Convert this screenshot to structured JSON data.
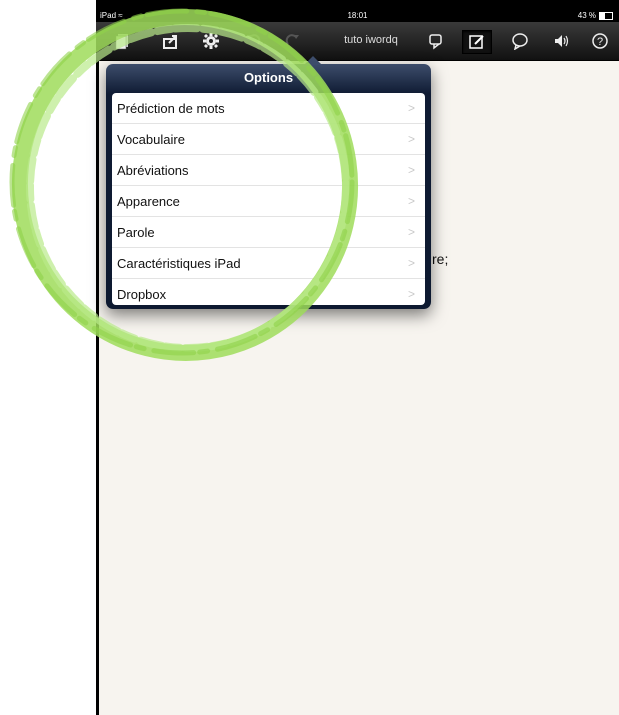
{
  "status": {
    "device": "iPad",
    "time": "18:01",
    "battery": "43 %"
  },
  "toolbar": {
    "doc_title": "tuto iwordq"
  },
  "popover": {
    "title": "Options",
    "items": [
      {
        "label": "Prédiction de mots"
      },
      {
        "label": "Vocabulaire"
      },
      {
        "label": "Abréviations"
      },
      {
        "label": "Apparence"
      },
      {
        "label": "Parole"
      },
      {
        "label": "Caractéristiques iPad"
      },
      {
        "label": "Dropbox"
      }
    ]
  },
  "document": {
    "visible_text": "re;"
  },
  "annotation": {
    "color": "#9fdc5a"
  }
}
